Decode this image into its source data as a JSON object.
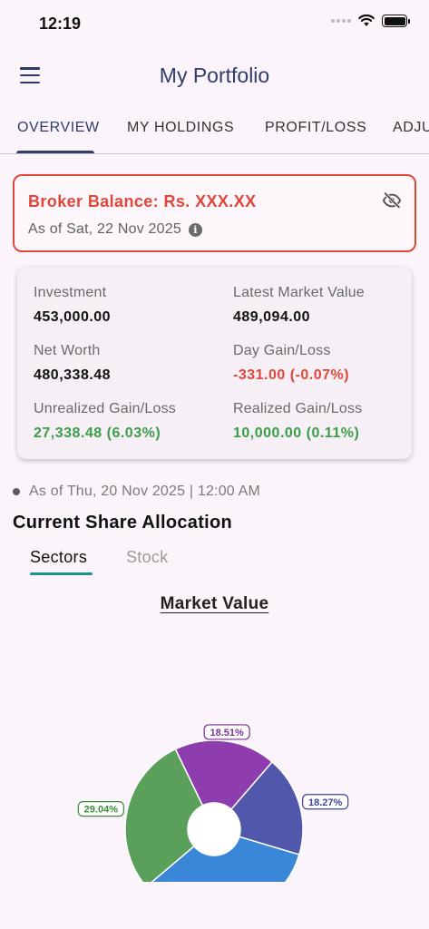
{
  "status_bar": {
    "time": "12:19"
  },
  "header": {
    "title": "My Portfolio"
  },
  "tabs": [
    {
      "label": "OVERVIEW"
    },
    {
      "label": "MY HOLDINGS"
    },
    {
      "label": "PROFIT/LOSS"
    },
    {
      "label": "ADJU"
    }
  ],
  "broker": {
    "title": "Broker Balance: Rs. XXX.XX",
    "as_of": "As of Sat, 22 Nov 2025"
  },
  "summary": {
    "investment": {
      "label": "Investment",
      "value": "453,000.00"
    },
    "latest_market_value": {
      "label": "Latest Market Value",
      "value": "489,094.00"
    },
    "net_worth": {
      "label": "Net Worth",
      "value": "480,338.48"
    },
    "day_gain_loss": {
      "label": "Day Gain/Loss",
      "value": "-331.00 (-0.07%)"
    },
    "unrealized": {
      "label": "Unrealized Gain/Loss",
      "value": "27,338.48 (6.03%)"
    },
    "realized": {
      "label": "Realized Gain/Loss",
      "value": "10,000.00 (0.11%)"
    }
  },
  "as_of_line": "As of Thu, 20 Nov 2025 | 12:00 AM",
  "allocation": {
    "title": "Current Share Allocation",
    "tabs": [
      {
        "label": "Sectors"
      },
      {
        "label": "Stock"
      }
    ],
    "chart_title": "Market Value"
  },
  "colors": {
    "accent": "#2f3d6e",
    "negative": "#e0473a",
    "positive": "#3a9d48",
    "sub_tab_indicator": "#1a9286"
  },
  "chart_data": {
    "type": "pie",
    "variant": "donut",
    "values": [
      18.51,
      18.27,
      34.18,
      29.04
    ],
    "labels": [
      "18.51%",
      "18.27%",
      "",
      "29.04%"
    ],
    "colors": [
      "#8e3dae",
      "#5158ab",
      "#3a87d8",
      "#5aa05a"
    ],
    "label_colors": [
      "#7b2f97",
      "#3d4597",
      "#3a87d8",
      "#3f8a3f"
    ]
  }
}
